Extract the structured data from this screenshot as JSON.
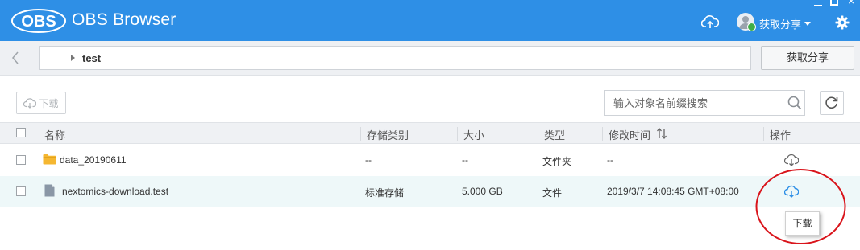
{
  "app": {
    "logo_text": "OBS",
    "title": "OBS Browser",
    "user_menu_label": "获取分享"
  },
  "navigation": {
    "current_path": "test",
    "share_button_label": "获取分享"
  },
  "toolbar": {
    "download_label": "下载",
    "search_placeholder": "输入对象名前缀搜索"
  },
  "table": {
    "columns": {
      "name": "名称",
      "storage_class": "存储类别",
      "size": "大小",
      "type": "类型",
      "modified": "修改时间",
      "actions": "操作"
    },
    "rows": [
      {
        "name": "data_20190611",
        "storage_class": "--",
        "size": "--",
        "type": "文件夹",
        "modified": "--",
        "icon": "folder-icon"
      },
      {
        "name": "nextomics-download.test",
        "storage_class": "标准存储",
        "size": "5.000 GB",
        "type": "文件",
        "modified": "2019/3/7 14:08:45 GMT+08:00",
        "icon": "file-icon"
      }
    ]
  },
  "tooltip": {
    "text": "下载"
  },
  "colors": {
    "titlebar": "#2e8fe6",
    "accent_blue": "#2e8fe6",
    "row_highlight": "#eef8f9",
    "annotation_red": "#d9141b"
  }
}
